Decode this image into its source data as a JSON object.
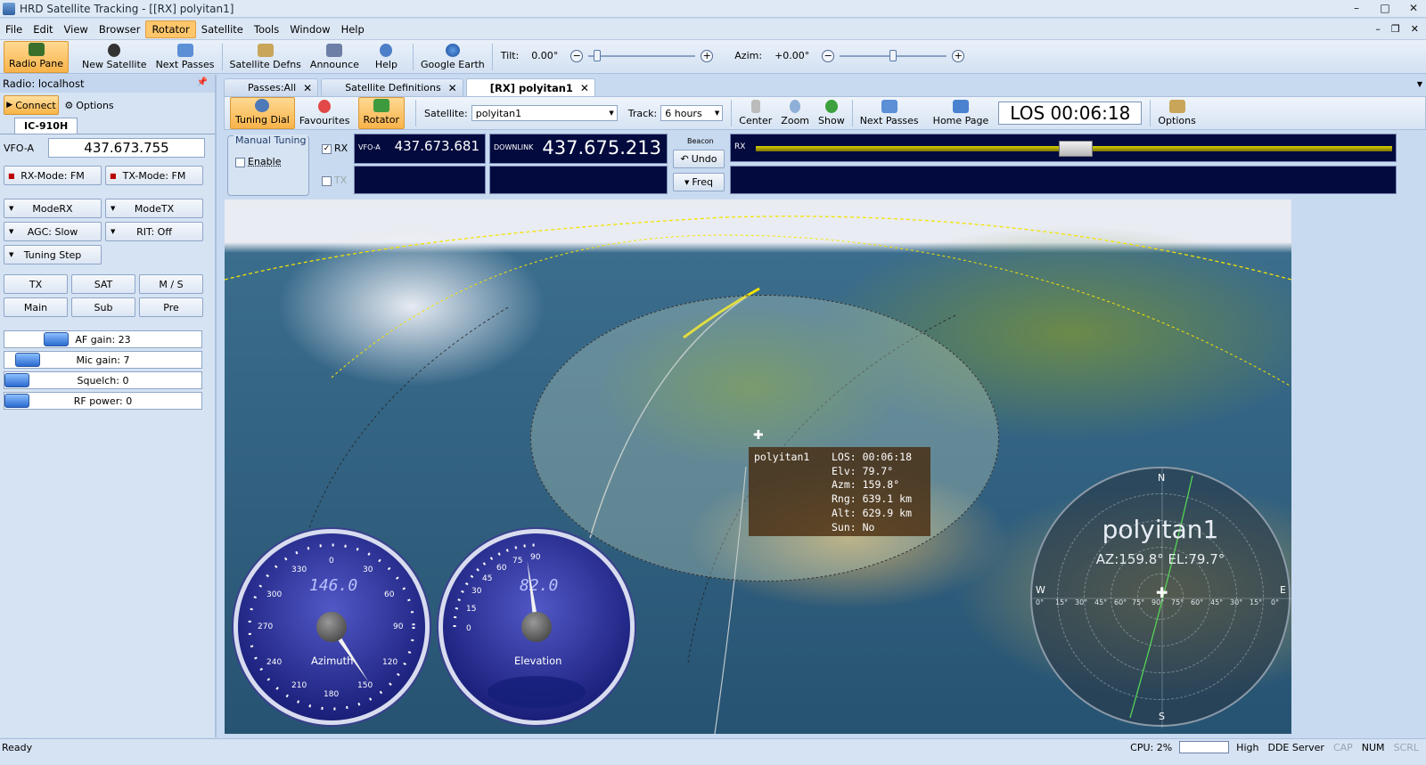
{
  "window": {
    "title": "HRD Satellite Tracking - [[RX]  polyitan1]"
  },
  "menu": [
    "File",
    "Edit",
    "View",
    "Browser",
    "Rotator",
    "Satellite",
    "Tools",
    "Window",
    "Help"
  ],
  "menu_active": "Rotator",
  "toolbar": {
    "radio_pane": "Radio Pane",
    "new_satellite": "New Satellite",
    "next_passes": "Next Passes",
    "satellite_defns": "Satellite Defns",
    "announce": "Announce",
    "help": "Help",
    "google_earth": "Google Earth",
    "tilt_label": "Tilt:",
    "tilt_value": "0.00°",
    "azim_label": "Azim:",
    "azim_value": "+0.00°"
  },
  "left_panel": {
    "header": "Radio: localhost",
    "connect": "Connect",
    "options": "Options",
    "radio_tab": "IC-910H",
    "vfo_label": "VFO-A",
    "vfo_value": "437.673.755",
    "rx_mode": "RX-Mode: FM",
    "tx_mode": "TX-Mode: FM",
    "mode_rx": "ModeRX",
    "mode_tx": "ModeTX",
    "agc": "AGC: Slow",
    "rit": "RIT: Off",
    "tuning_step": "Tuning Step",
    "tx": "TX",
    "sat": "SAT",
    "ms": "M / S",
    "main": "Main",
    "sub": "Sub",
    "pre": "Pre",
    "af_gain": "AF gain: 23",
    "mic_gain": "Mic gain: 7",
    "squelch": "Squelch: 0",
    "rf_power": "RF power: 0"
  },
  "tabs": [
    {
      "label": "Passes:All"
    },
    {
      "label": "Satellite Definitions"
    },
    {
      "label": "[RX]  polyitan1",
      "active": true
    }
  ],
  "sat_toolbar": {
    "tuning_dial": "Tuning Dial",
    "favourites": "Favourites",
    "rotator": "Rotator",
    "satellite_label": "Satellite:",
    "satellite_value": "polyitan1",
    "track_label": "Track:",
    "track_value": "6 hours",
    "center": "Center",
    "zoom": "Zoom",
    "show": "Show",
    "next_passes": "Next Passes",
    "home_page": "Home Page",
    "los": "LOS 00:06:18",
    "options": "Options"
  },
  "tuning": {
    "manual_tuning": "Manual Tuning",
    "enable": "Enable",
    "rx": "RX",
    "tx": "TX",
    "vfoa_label": "VFO-A",
    "vfoa_value": "437.673.681",
    "downlink_label": "DOWNLINK",
    "downlink_value": "437.675.213",
    "beacon": "Beacon",
    "undo": "Undo",
    "freq": "Freq",
    "rx_bar_label": "RX"
  },
  "infobox": {
    "name": "polyitan1",
    "los": "LOS: 00:06:18",
    "elv": "Elv: 79.7°",
    "azm": "Azm: 159.8°",
    "rng": "Rng: 639.1 km",
    "alt": "Alt: 629.9 km",
    "sun": "Sun: No"
  },
  "azimuth_gauge": {
    "digits": "146.0",
    "label": "Azimuth",
    "value_deg": 146,
    "ticks": [
      "0",
      "30",
      "60",
      "90",
      "120",
      "150",
      "180",
      "210",
      "240",
      "270",
      "300",
      "330"
    ]
  },
  "elevation_gauge": {
    "digits": "82.0",
    "label": "Elevation",
    "value_deg": 82,
    "ticks": [
      "0",
      "15",
      "30",
      "45",
      "60",
      "75",
      "90"
    ]
  },
  "radar": {
    "name": "polyitan1",
    "azel": "AZ:159.8°  EL:79.7°",
    "n": "N",
    "s": "S",
    "e": "E",
    "w": "W",
    "degrees": [
      "0°",
      "15°",
      "30°",
      "45°",
      "60°",
      "75°",
      "90°",
      "75°",
      "60°",
      "45°",
      "30°",
      "15°",
      "0°"
    ]
  },
  "status": {
    "ready": "Ready",
    "cpu": "CPU: 2%",
    "high": "High",
    "dde": "DDE Server",
    "cap": "CAP",
    "num": "NUM",
    "scrl": "SCRL"
  }
}
